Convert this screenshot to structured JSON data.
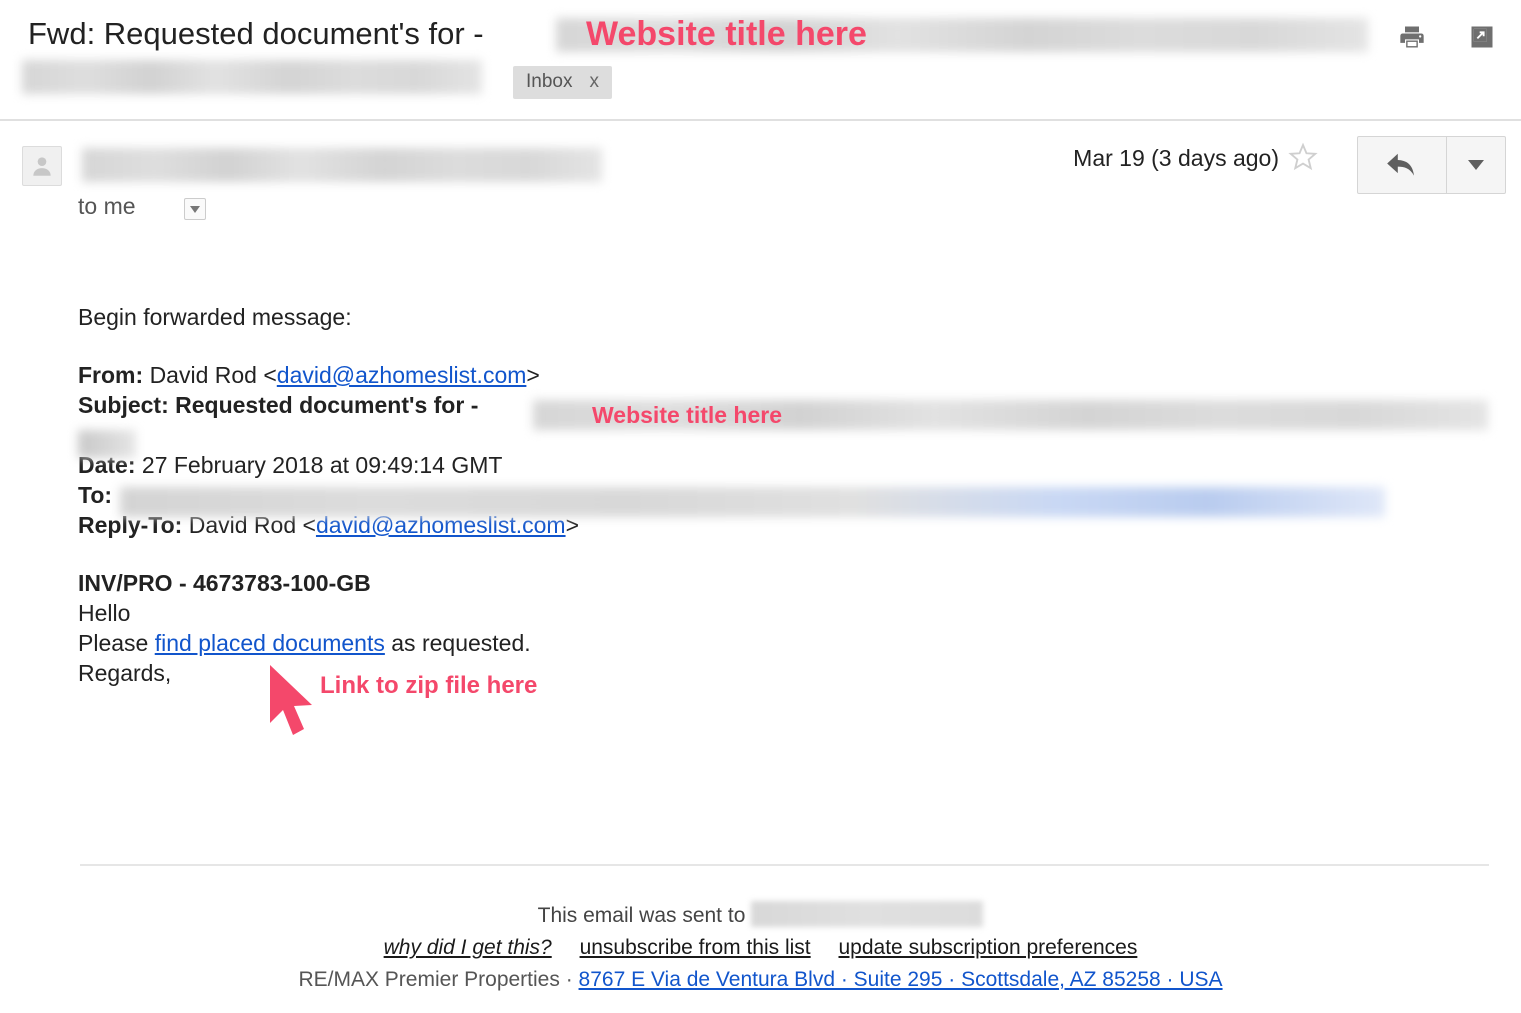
{
  "header": {
    "subject_prefix": "Fwd: Requested document's for -",
    "label_chip": "Inbox",
    "label_chip_close": "x",
    "print_icon": "print-icon",
    "popout_icon": "open-in-new-window-icon"
  },
  "annotations": {
    "website_title_top": "Website title here",
    "website_title_subject": "Website title here",
    "zip_link_note": "Link to zip file here",
    "color": "#f4486b"
  },
  "message": {
    "to_me": "to me",
    "date_received": "Mar 19 (3 days ago)",
    "star_icon": "star-outline-icon",
    "reply_icon": "reply-arrow-icon",
    "more_icon": "chevron-down-icon",
    "avatar_icon": "person-avatar-icon"
  },
  "body": {
    "begin_forwarded": "Begin forwarded message:",
    "from_label": "From:",
    "from_name": "David Rod <",
    "from_email": "david@azhomeslist.com",
    "from_close": ">",
    "subject_label": "Subject:",
    "subject_value": "Requested document's for -",
    "date_label": "Date:",
    "date_value": "27 February 2018 at 09:49:14 GMT",
    "to_label": "To:",
    "replyto_label": "Reply-To:",
    "replyto_name": "David Rod <",
    "replyto_email": "david@azhomeslist.com",
    "replyto_close": ">",
    "invoice_ref": "INV/PRO - 4673783-100-GB",
    "greeting": "Hello",
    "please_text": "Please ",
    "link_text": "find placed documents",
    "as_requested": " as requested.",
    "regards": "Regards,"
  },
  "footer": {
    "sent_to_prefix": "This email was sent to",
    "why_did_i_get_this": "why did I get this?",
    "unsubscribe": "unsubscribe from this list",
    "update_prefs": "update subscription preferences",
    "company": "RE/MAX Premier Properties · ",
    "address": "8767 E Via de Ventura Blvd · Suite 295 · Scottsdale, AZ 85258 · USA"
  }
}
